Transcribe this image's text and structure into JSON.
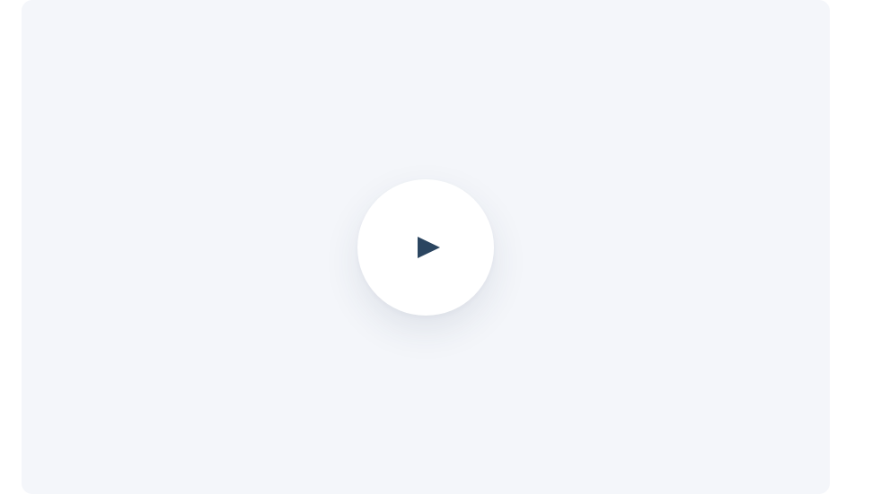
{
  "video": {
    "panel_color": "#f4f6fa",
    "play_button": {
      "icon": "play-icon",
      "background": "#ffffff",
      "icon_color": "#2b4560"
    }
  }
}
